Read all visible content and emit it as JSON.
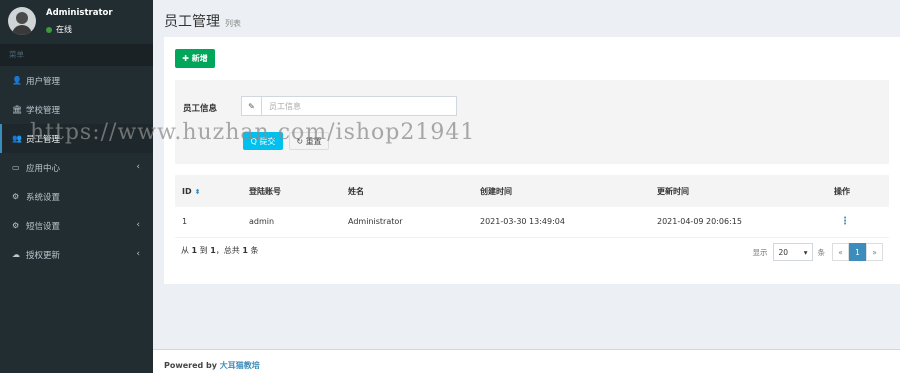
{
  "sidebar": {
    "user": {
      "name": "Administrator",
      "status": "在线"
    },
    "menu_header": "菜单",
    "items": [
      {
        "icon": "user-icon",
        "glyph": "👤",
        "label": "用户管理",
        "has_submenu": false
      },
      {
        "icon": "school-icon",
        "glyph": "🏛",
        "label": "学校管理",
        "has_submenu": false
      },
      {
        "icon": "users-icon",
        "glyph": "👥",
        "label": "员工管理",
        "has_submenu": false,
        "active": true
      },
      {
        "icon": "app-center-icon",
        "glyph": "▭",
        "label": "应用中心",
        "has_submenu": true
      },
      {
        "icon": "cogs-icon",
        "glyph": "⚙",
        "label": "系统设置",
        "has_submenu": false
      },
      {
        "icon": "sms-settings-icon",
        "glyph": "⚙",
        "label": "短信设置",
        "has_submenu": true
      },
      {
        "icon": "cloud-icon",
        "glyph": "☁",
        "label": "授权更新",
        "has_submenu": true
      }
    ]
  },
  "page": {
    "title": "员工管理",
    "subtitle": "列表"
  },
  "toolbar": {
    "add_label": "✚ 新增"
  },
  "filter": {
    "label": "员工信息",
    "placeholder": "员工信息",
    "submit_label": "Q 提交",
    "reset_label": "↻ 重置"
  },
  "table": {
    "columns": [
      "ID",
      "登陆账号",
      "姓名",
      "创建时间",
      "更新时间",
      "操作"
    ],
    "rows": [
      {
        "id": "1",
        "account": "admin",
        "name": "Administrator",
        "created": "2021-03-30 13:49:04",
        "updated": "2021-04-09 20:06:15"
      }
    ]
  },
  "pagination": {
    "summary_prefix": "从",
    "from": "1",
    "to_word": "到",
    "to": "1",
    "total_prefix": "，总共",
    "total": "1",
    "unit": "条",
    "show_label": "显示",
    "page_size": "20",
    "per_label": "条",
    "prev": "«",
    "current": "1",
    "next": "»"
  },
  "footer": {
    "powered_by": "Powered by",
    "brand": "大耳猫教培"
  },
  "watermark": "https://www.huzhan.com/ishop21941",
  "colors": {
    "sidebar_bg": "#222d32",
    "accent": "#3c8dbc",
    "success": "#00a65a",
    "info": "#00c0ef"
  }
}
